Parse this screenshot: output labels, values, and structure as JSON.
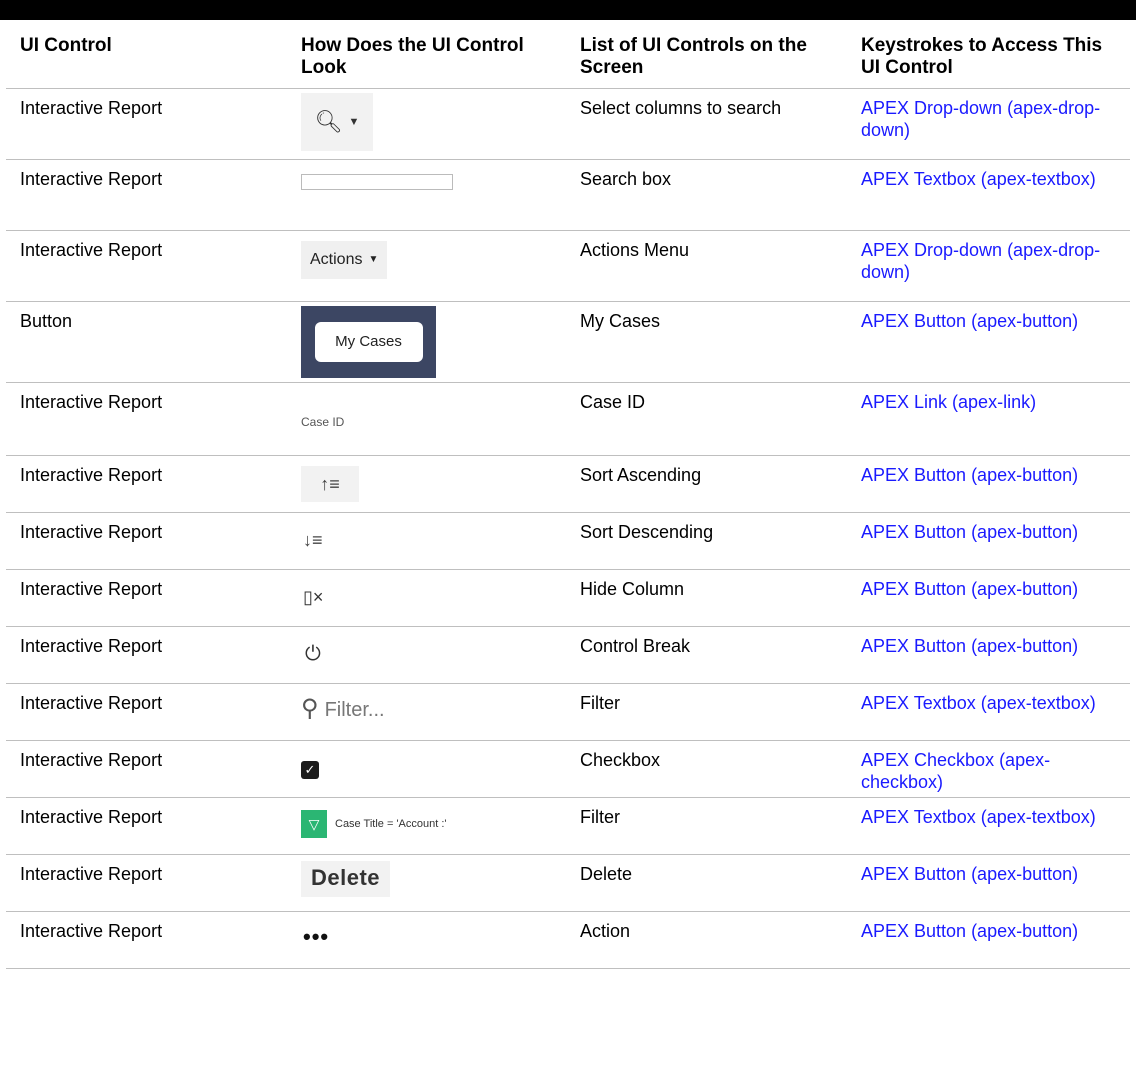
{
  "headers": {
    "col1": "UI Control",
    "col2": "How Does the UI Control Look",
    "col3": "List of UI Controls on the Screen",
    "col4": "Keystrokes to Access This UI Control"
  },
  "rows": [
    {
      "control": "Interactive Report",
      "visual": "search-dropdown",
      "screen_name": "Select columns to search",
      "access": "APEX Drop-down (apex-drop-down)"
    },
    {
      "control": "Interactive Report",
      "visual": "search-textbox",
      "screen_name": "Search box",
      "access": "APEX Textbox (apex-textbox)"
    },
    {
      "control": "Interactive Report",
      "visual": "actions-menu",
      "visual_text": "Actions",
      "screen_name": "Actions Menu",
      "access": "APEX Drop-down (apex-drop-down)"
    },
    {
      "control": "Button",
      "visual": "button",
      "visual_text": "My Cases",
      "screen_name": "My Cases",
      "access": "APEX Button (apex-button)"
    },
    {
      "control": "Interactive Report",
      "visual": "column-link",
      "visual_text": "Case ID",
      "screen_name": "Case ID",
      "access": "APEX Link (apex-link)"
    },
    {
      "control": "Interactive Report",
      "visual": "sort-ascending-icon",
      "screen_name": "Sort Ascending",
      "access": "APEX Button (apex-button)"
    },
    {
      "control": "Interactive Report",
      "visual": "sort-descending-icon",
      "screen_name": "Sort Descending",
      "access": "APEX Button (apex-button)"
    },
    {
      "control": "Interactive Report",
      "visual": "hide-column-icon",
      "screen_name": "Hide Column",
      "access": "APEX Button (apex-button)"
    },
    {
      "control": "Interactive Report",
      "visual": "control-break-icon",
      "screen_name": "Control Break",
      "access": "APEX Button (apex-button)"
    },
    {
      "control": "Interactive Report",
      "visual": "filter-input",
      "visual_text": "Filter...",
      "screen_name": "Filter",
      "access": "APEX Textbox (apex-textbox)"
    },
    {
      "control": "Interactive Report",
      "visual": "checkbox-checked",
      "screen_name": "Checkbox",
      "access": "APEX Checkbox (apex-checkbox)"
    },
    {
      "control": "Interactive Report",
      "visual": "filter-chip",
      "visual_text": "Case Title = 'Account :'",
      "screen_name": "Filter",
      "access": "APEX Textbox (apex-textbox)"
    },
    {
      "control": "Interactive Report",
      "visual": "delete-button",
      "visual_text": "Delete",
      "screen_name": "Delete",
      "access": "APEX Button (apex-button)"
    },
    {
      "control": "Interactive Report",
      "visual": "more-actions-icon",
      "screen_name": "Action",
      "access": "APEX Button (apex-button)"
    }
  ],
  "colors": {
    "link": "#1a1aff",
    "topbar": "#000000",
    "filter_chip": "#2bb673",
    "button_frame": "#3c4663"
  }
}
